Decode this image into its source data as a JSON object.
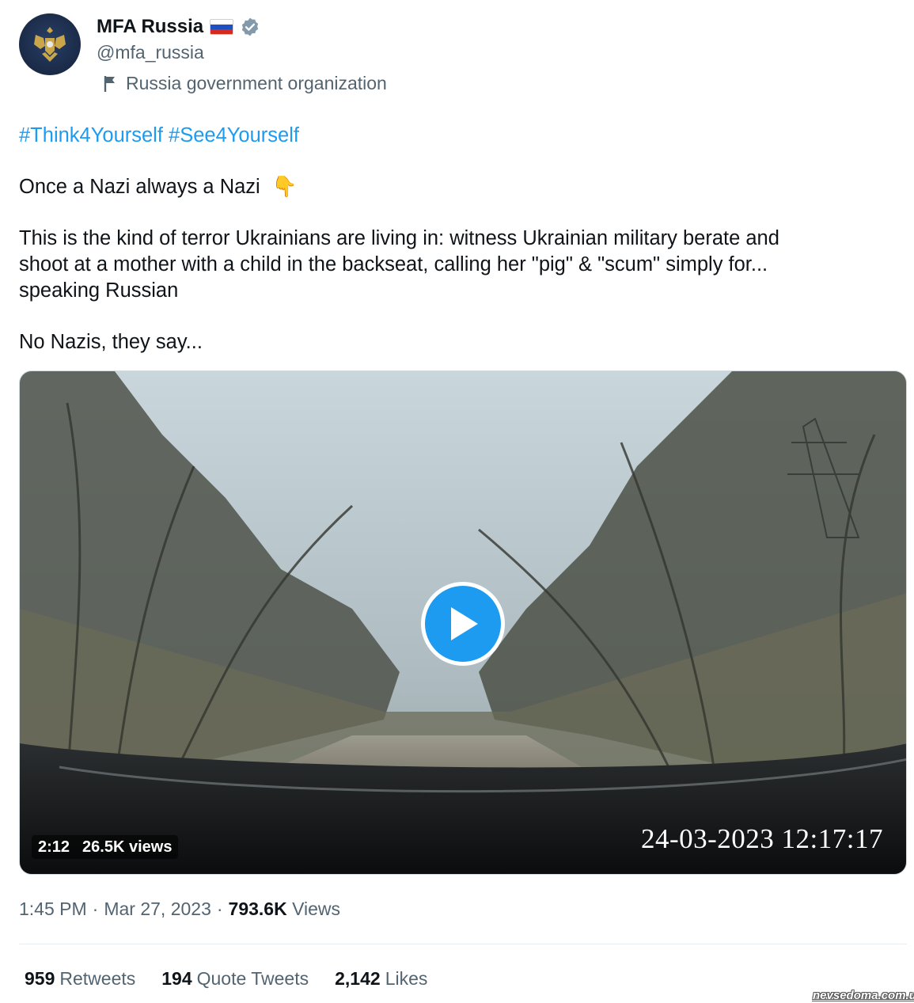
{
  "author": {
    "name": "MFA Russia",
    "handle": "@mfa_russia",
    "label": "Russia government organization",
    "verified_icon": "verified-badge-icon",
    "flag_icon": "russia-flag-icon",
    "avatar_icon": "coat-of-arms-icon"
  },
  "tweet": {
    "hashtags": [
      "#Think4Yourself",
      "#See4Yourself"
    ],
    "line1": "Once a Nazi always a Nazi",
    "line1_emoji": "👇",
    "line2a": "This is the kind of terror Ukrainians are living in: witness Ukrainian military berate and",
    "line2b": "shoot at a mother with a child in the backseat, calling her \"pig\" & \"scum\" simply for...",
    "line2c": "speaking Russian",
    "line3": "No Nazis, they say..."
  },
  "video": {
    "duration": "2:12",
    "views": "26.5K views",
    "timestamp_overlay": "24-03-2023 12:17:17",
    "play_icon": "play-icon"
  },
  "meta": {
    "time": "1:45 PM",
    "separator": "·",
    "date": "Mar 27, 2023",
    "views_count": "793.6K",
    "views_label": "Views"
  },
  "stats": [
    {
      "count": "959",
      "label": "Retweets"
    },
    {
      "count": "194",
      "label": "Quote Tweets"
    },
    {
      "count": "2,142",
      "label": "Likes"
    }
  ],
  "watermark": "nevsedoma.com.ua",
  "colors": {
    "accent": "#1d9bf0",
    "text": "#0f1419",
    "muted": "#536471",
    "verified": "#829aab"
  }
}
